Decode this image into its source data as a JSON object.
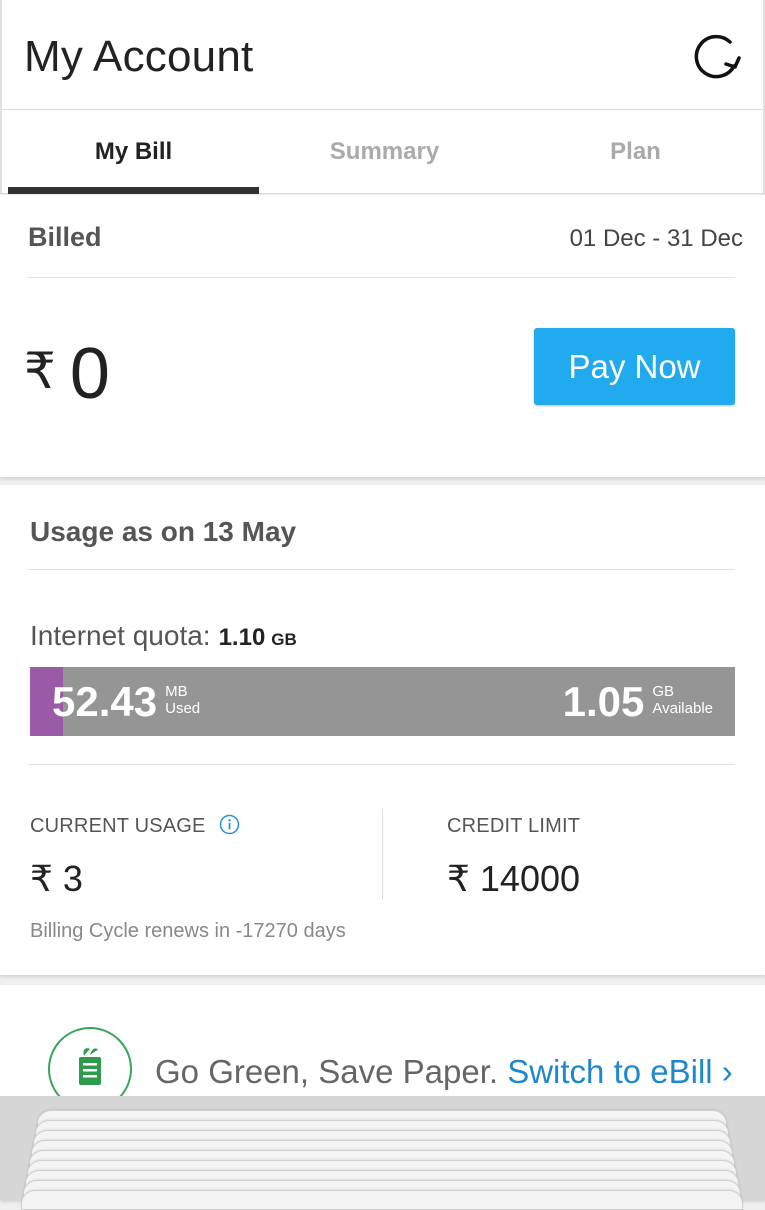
{
  "header": {
    "title": "My Account",
    "refresh_icon": "refresh-icon"
  },
  "tabs": [
    {
      "label": "My Bill",
      "active": true
    },
    {
      "label": "Summary",
      "active": false
    },
    {
      "label": "Plan",
      "active": false
    }
  ],
  "billed": {
    "label": "Billed",
    "dates": "01 Dec - 31 Dec",
    "currency": "₹",
    "amount": "0",
    "pay_button": "Pay Now"
  },
  "usage": {
    "title": "Usage as on 13 May",
    "quota_label": "Internet quota:",
    "quota_value": "1.10",
    "quota_unit": "GB",
    "used_value": "52.43",
    "used_unit": "MB",
    "used_label": "Used",
    "used_fraction": 0.047,
    "available_value": "1.05",
    "available_unit": "GB",
    "available_label": "Available",
    "current_usage_label": "CURRENT USAGE",
    "current_usage_value": "₹ 3",
    "credit_limit_label": "CREDIT LIMIT",
    "credit_limit_value": "₹ 14000",
    "renew_text": "Billing Cycle renews in -17270 days"
  },
  "green": {
    "text": "Go Green, Save Paper.",
    "link": "Switch to eBill ›"
  },
  "colors": {
    "accent": "#22aaee",
    "used_bar": "#9a5aa5",
    "bar_bg": "#959595",
    "green": "#3aa55a",
    "link": "#1e88cc"
  }
}
